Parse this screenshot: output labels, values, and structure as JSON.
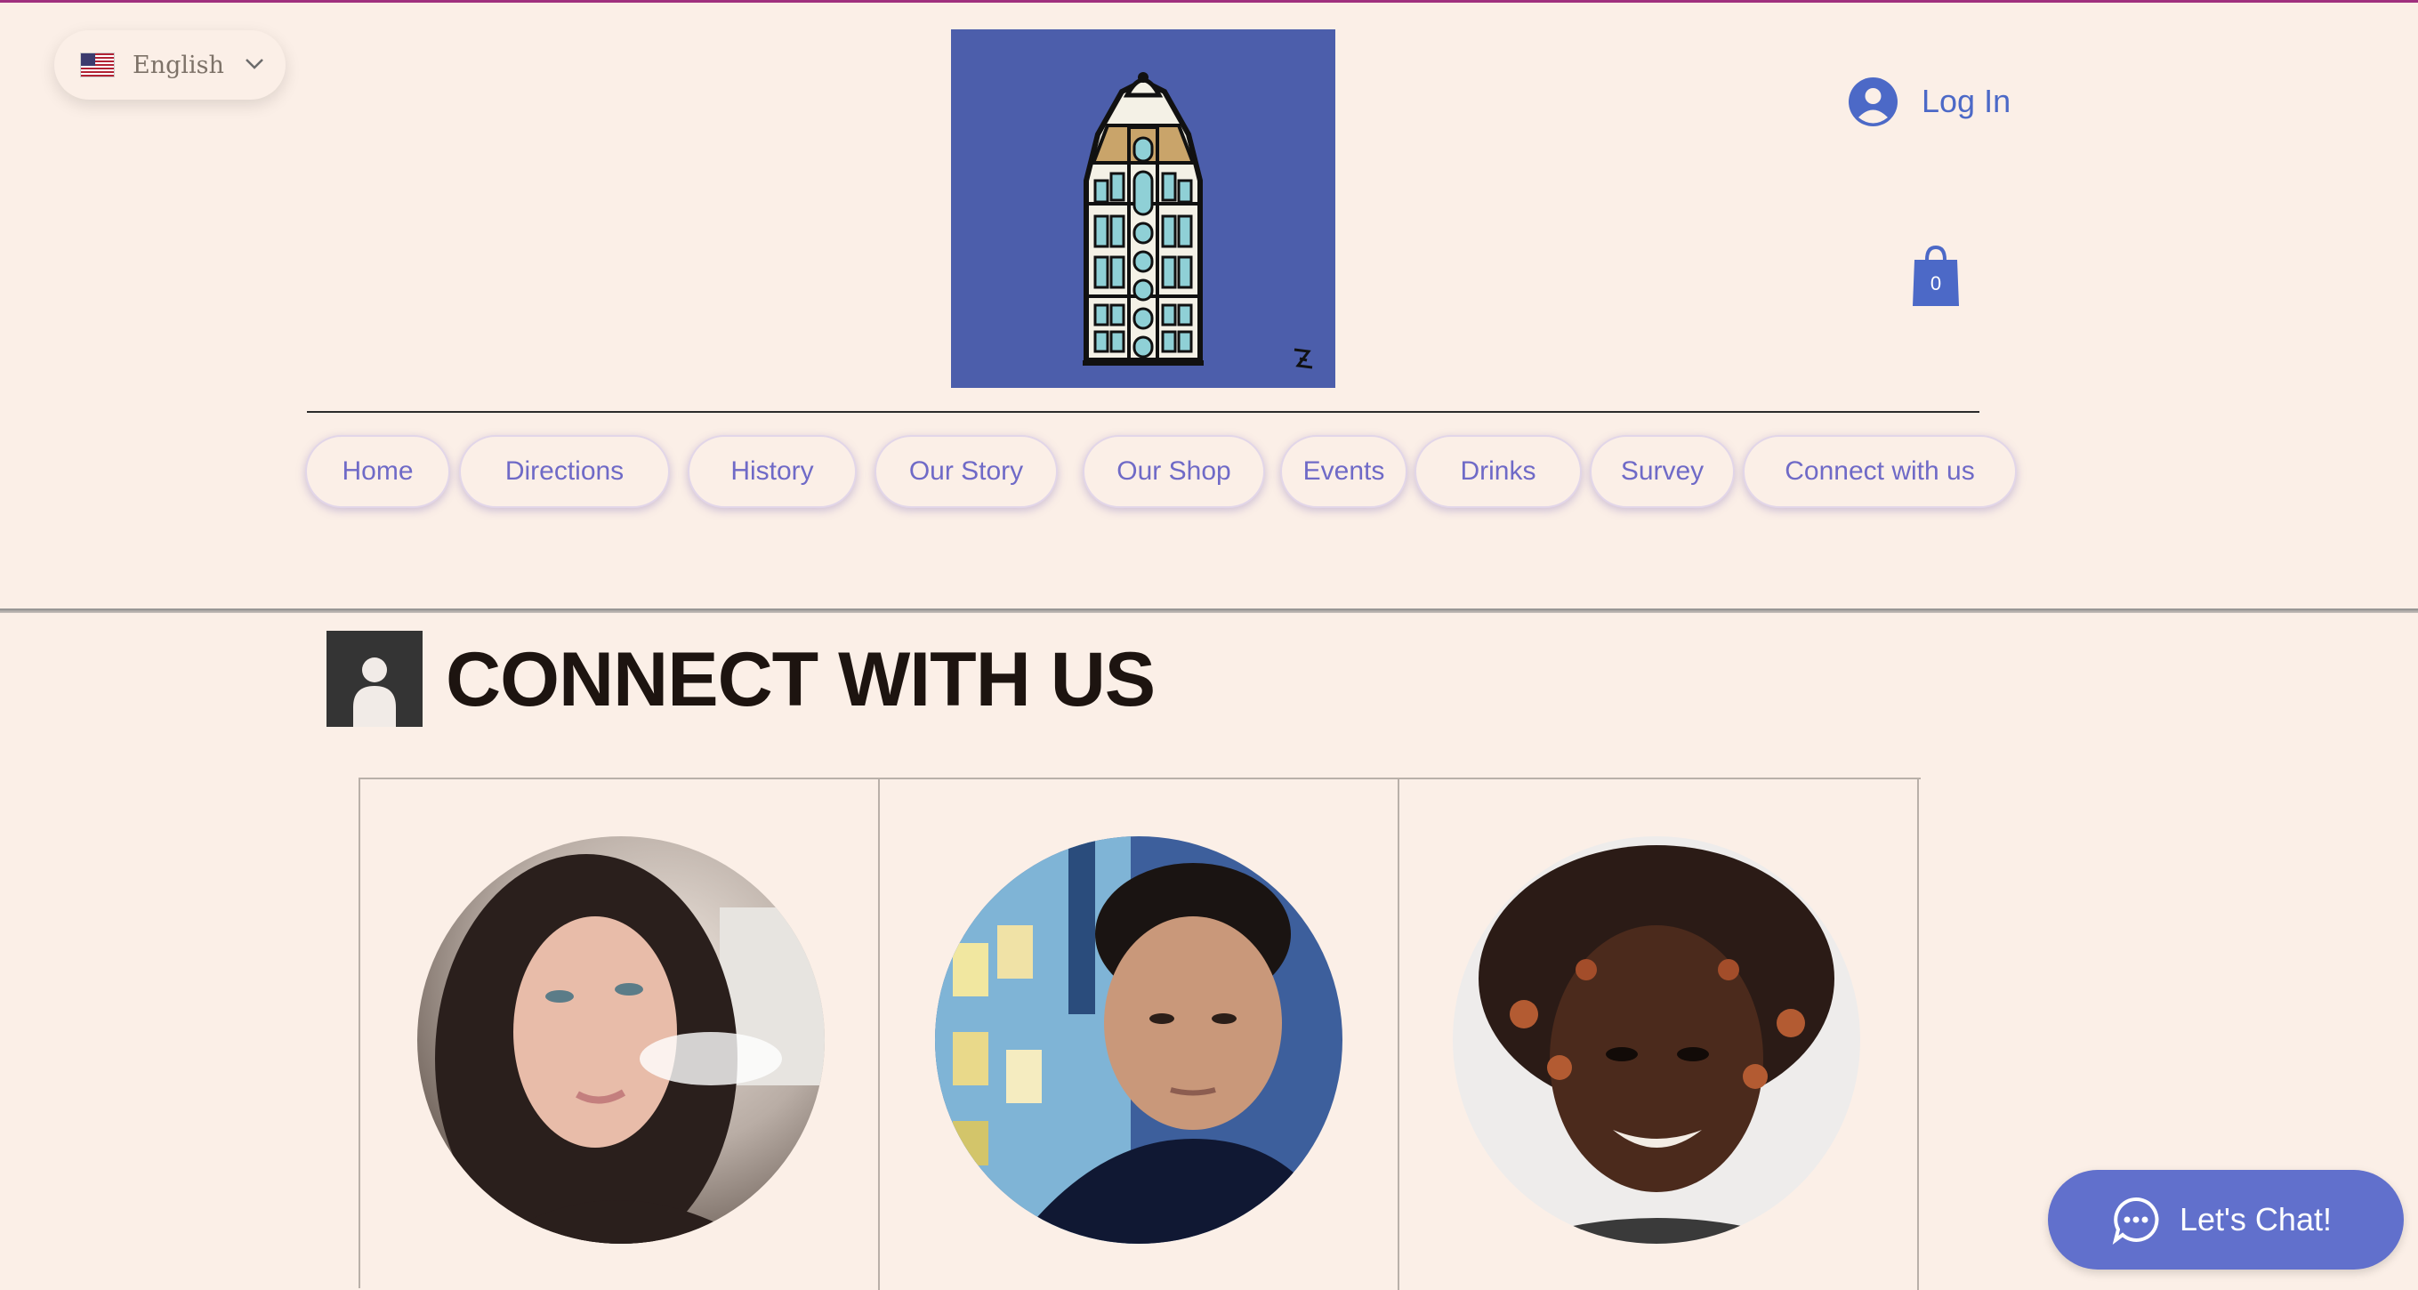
{
  "language": {
    "label": "English",
    "flag_icon": "us-flag-icon"
  },
  "header": {
    "logo_alt": "Flatiron building logo",
    "login_label": "Log In",
    "cart_count": "0"
  },
  "nav": {
    "items": [
      {
        "label": "Home"
      },
      {
        "label": "Directions"
      },
      {
        "label": "History"
      },
      {
        "label": "Our Story"
      },
      {
        "label": "Our Shop"
      },
      {
        "label": "Events"
      },
      {
        "label": "Drinks"
      },
      {
        "label": "Survey"
      },
      {
        "label": "Connect with us"
      }
    ]
  },
  "section": {
    "title": "CONNECT WITH US"
  },
  "team": [
    {
      "portrait": "person-1"
    },
    {
      "portrait": "person-2"
    },
    {
      "portrait": "person-3"
    }
  ],
  "chat": {
    "label": "Let's Chat!"
  },
  "colors": {
    "background": "#fbefe7",
    "accent": "#6170cc",
    "nav_text": "#6f6ac7",
    "logo_bg": "#4c5eab",
    "top_border": "#a0307e"
  }
}
